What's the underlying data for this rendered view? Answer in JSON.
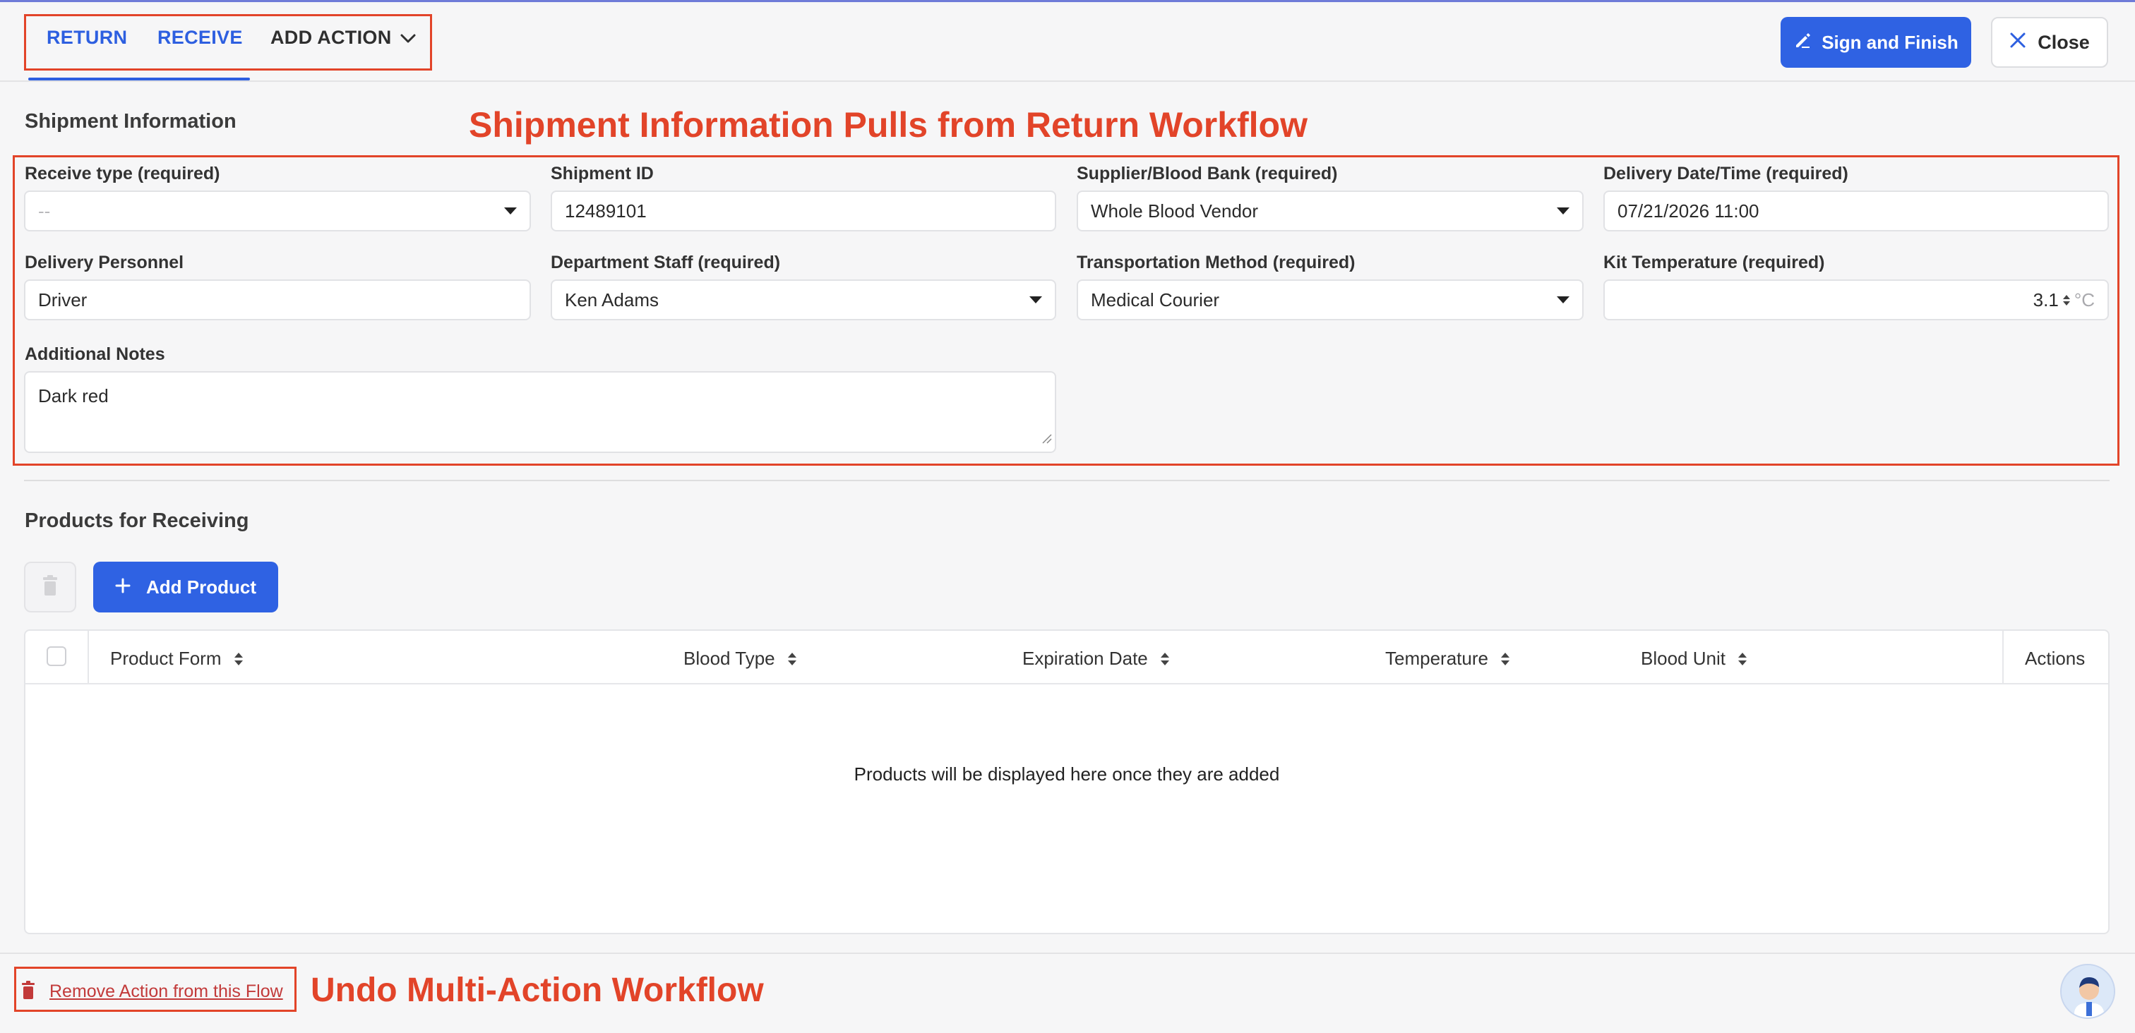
{
  "tabs": [
    {
      "label": "RETURN"
    },
    {
      "label": "RECEIVE"
    },
    {
      "label": "ADD ACTION"
    }
  ],
  "header": {
    "sign_finish_label": "Sign and Finish",
    "close_label": "Close"
  },
  "shipment": {
    "title": "Shipment Information",
    "annotation": "Shipment Information Pulls from Return Workflow",
    "fields": {
      "receive_type": {
        "label": "Receive type (required)",
        "value": "--"
      },
      "shipment_id": {
        "label": "Shipment ID",
        "value": "12489101"
      },
      "supplier": {
        "label": "Supplier/Blood Bank (required)",
        "value": "Whole Blood Vendor"
      },
      "delivery_datetime": {
        "label": "Delivery Date/Time (required)",
        "value": "07/21/2026 11:00"
      },
      "delivery_personnel": {
        "label": "Delivery Personnel",
        "value": "Driver"
      },
      "department_staff": {
        "label": "Department Staff (required)",
        "value": "Ken Adams"
      },
      "transport_method": {
        "label": "Transportation Method (required)",
        "value": "Medical Courier"
      },
      "kit_temperature": {
        "label": "Kit Temperature (required)",
        "value": "3.1",
        "unit": "°C"
      },
      "notes": {
        "label": "Additional Notes",
        "value": "Dark red"
      }
    }
  },
  "products": {
    "title": "Products for Receiving",
    "add_label": "Add Product",
    "columns": [
      "Product Form",
      "Blood Type",
      "Expiration Date",
      "Temperature",
      "Blood Unit",
      "Actions"
    ],
    "empty_message": "Products will be displayed here once they are added"
  },
  "footer": {
    "remove_label": "Remove Action from this Flow",
    "annotation": "Undo Multi-Action Workflow"
  },
  "colors": {
    "primary": "#2f62e3",
    "annotation": "#e24429",
    "danger": "#c23a3a"
  }
}
